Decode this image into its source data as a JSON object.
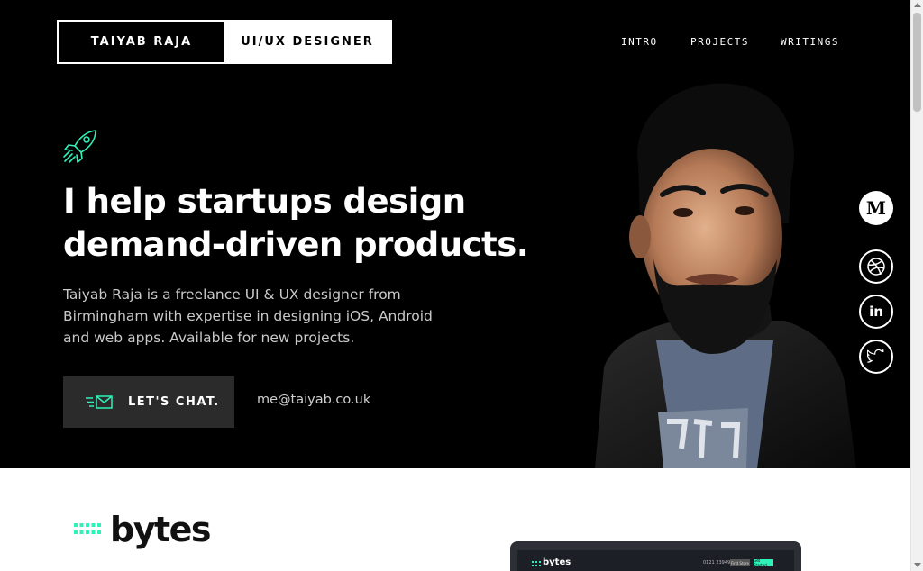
{
  "header": {
    "name": "TAIYAB RAJA",
    "role": "UI/UX DESIGNER"
  },
  "nav": {
    "items": [
      {
        "label": "INTRO"
      },
      {
        "label": "PROJECTS"
      },
      {
        "label": "WRITINGS"
      }
    ]
  },
  "hero": {
    "headline_line1": "I help startups design",
    "headline_line2": "demand-driven products.",
    "blurb_line1": "Taiyab Raja is a freelance UI & UX designer from",
    "blurb_line2": "Birmingham with expertise in designing iOS, Android",
    "blurb_line3": "and web apps. Available for new projects.",
    "cta_label": "LET'S CHAT.",
    "email": "me@taiyab.co.uk"
  },
  "social": {
    "medium_letter": "M",
    "linkedin_text": "in"
  },
  "projects": {
    "bytes_name": "bytes",
    "mock_logo": "bytes",
    "mock_phone": "0121 2394900",
    "mock_button": "Find Store",
    "mock_cta": "Get Started"
  },
  "colors": {
    "accent": "#2ef2b8",
    "hero_bg": "#000000",
    "button_bg": "#2b2b2b"
  },
  "icons": [
    "rocket-icon",
    "mail-icon",
    "medium-icon",
    "dribbble-icon",
    "linkedin-icon",
    "twitter-icon"
  ]
}
